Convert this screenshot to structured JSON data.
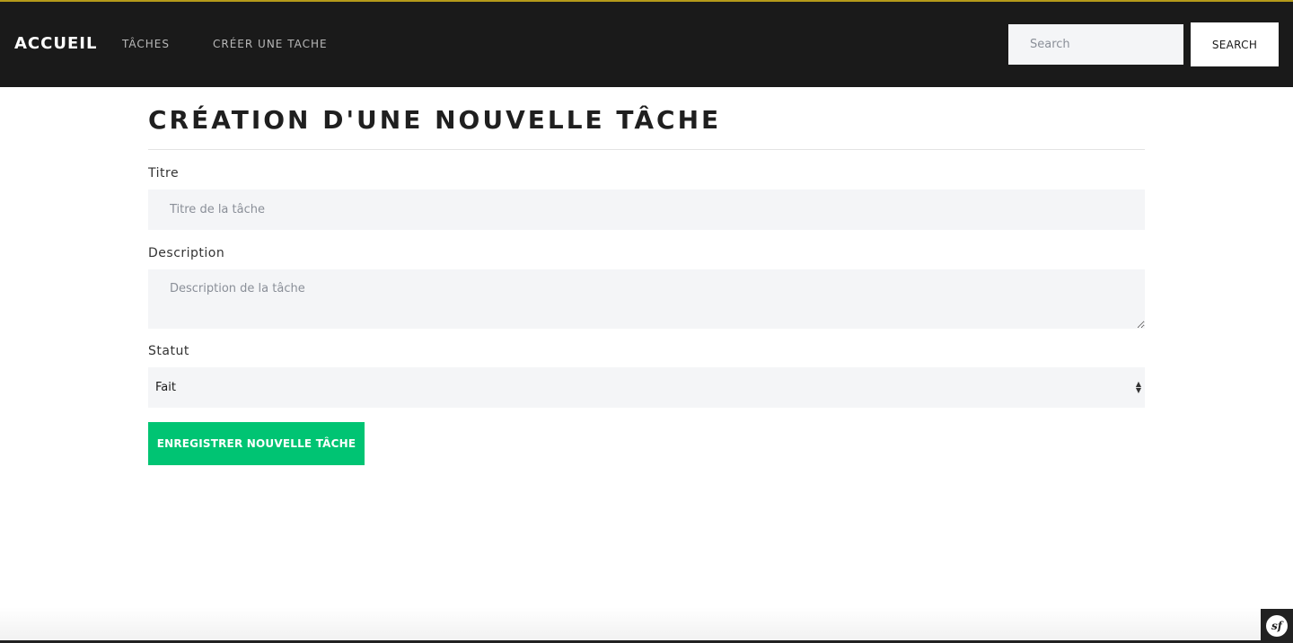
{
  "navbar": {
    "brand": "ACCUEIL",
    "links": [
      "TÂCHES",
      "CRÉER UNE TACHE"
    ],
    "search_placeholder": "Search",
    "search_button": "SEARCH",
    "accent_color": "#b59a1a",
    "background_color": "#1a1a1a"
  },
  "page": {
    "title": "CRÉATION D'UNE NOUVELLE TÂCHE"
  },
  "form": {
    "titre_label": "Titre",
    "titre_placeholder": "Titre de la tâche",
    "description_label": "Description",
    "description_placeholder": "Description de la tâche",
    "statut_label": "Statut",
    "statut_selected": "Fait",
    "submit_label": "ENREGISTRER NOUVELLE TÂCHE",
    "submit_color": "#00c473"
  },
  "debug_toolbar": {
    "logo_icon": "symfony-icon",
    "logo_text": "sf"
  }
}
